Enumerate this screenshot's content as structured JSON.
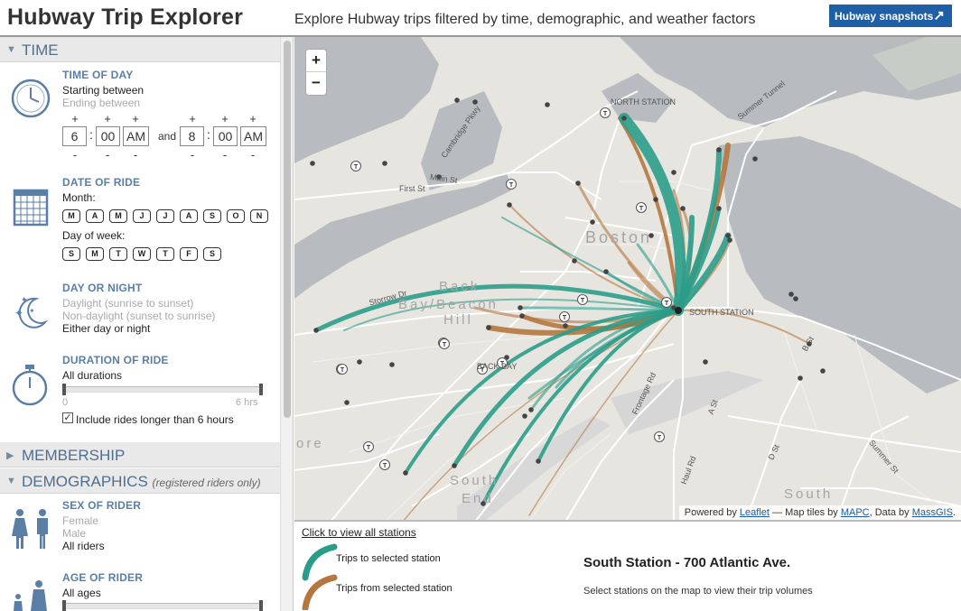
{
  "header": {
    "title": "Hubway Trip Explorer",
    "subtitle": "Explore Hubway trips filtered by time, demographic, and weather factors",
    "snapshots_label": "Hubway snapshots",
    "snapshots_icon": "external-arrow-icon"
  },
  "sidebar": {
    "time_section": "TIME",
    "time_of_day": {
      "title": "TIME OF DAY",
      "starting": "Starting between",
      "ending": "Ending between",
      "start_hour": "6",
      "start_min": "00",
      "start_ampm": "AM",
      "and": "and",
      "end_hour": "8",
      "end_min": "00",
      "end_ampm": "AM",
      "plus": "+",
      "minus": "-"
    },
    "date_of_ride": {
      "title": "DATE OF RIDE",
      "month_label": "Month:",
      "months": [
        "M",
        "A",
        "M",
        "J",
        "J",
        "A",
        "S",
        "O",
        "N"
      ],
      "dow_label": "Day of week:",
      "days": [
        "S",
        "M",
        "T",
        "W",
        "T",
        "F",
        "S"
      ]
    },
    "day_or_night": {
      "title": "DAY OR NIGHT",
      "opt1": "Daylight (sunrise to sunset)",
      "opt2": "Non-daylight (sunset to sunrise)",
      "opt3": "Either day or night"
    },
    "duration": {
      "title": "DURATION OF RIDE",
      "value": "All durations",
      "min_label": "0",
      "max_label": "6 hrs",
      "include_long": "Include rides longer than 6 hours",
      "check": "✓"
    },
    "membership_section": "MEMBERSHIP",
    "demographics_section": "DEMOGRAPHICS",
    "demographics_note": "(registered riders only)",
    "sex": {
      "title": "SEX OF RIDER",
      "opt1": "Female",
      "opt2": "Male",
      "opt3": "All riders"
    },
    "age": {
      "title": "AGE OF RIDER",
      "value": "All ages"
    },
    "triangle_down": "▼",
    "triangle_right": "▶"
  },
  "map": {
    "zoom_in": "+",
    "zoom_out": "−",
    "attribution": {
      "prefix": "Powered by",
      "leaflet": "Leaflet",
      "tiles": "— Map tiles by",
      "mapc": "MAPC",
      "data": ", Data by",
      "massgis": "MassGIS",
      "end": "."
    },
    "labels": {
      "north_station": "NORTH STATION",
      "south_station": "SOUTH STATION",
      "back_bay": "BACK BAY",
      "storrow": "Storrow Dr",
      "main_st": "Main St",
      "first_st": "First St",
      "cambridge": "Cambridge Pkwy",
      "summer_tunnel": "Summer Tunnel",
      "frontage": "Frontage Rd",
      "a_st": "A St",
      "d_st": "D St",
      "b_st": "B St",
      "haul": "Haul Rd",
      "summer_st": "Summer St"
    },
    "areas": {
      "boston": "Boston",
      "back_bay_hill_1": "Back",
      "back_bay_hill_2": "Bay/Beacon",
      "back_bay_hill_3": "Hill",
      "south_end_1": "South",
      "south_end_2": "End",
      "south": "South",
      "more": "ore"
    },
    "colors": {
      "to_station": "#2a9d8a",
      "from_station": "#b5773f",
      "water": "#b5b9bd",
      "land": "#e7e5df"
    }
  },
  "bottom": {
    "view_all": "Click to view all stations",
    "legend_to": "Trips to selected station",
    "legend_from": "Trips from selected station",
    "station_name": "South Station - 700 Atlantic Ave.",
    "hint": "Select stations on the map to view their trip volumes"
  }
}
